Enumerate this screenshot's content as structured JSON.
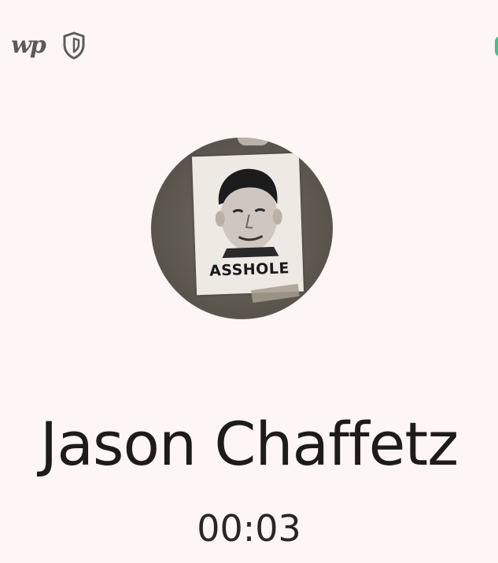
{
  "status_bar": {
    "left_icons": [
      "washington-post-icon",
      "shield-icon"
    ],
    "wp_logo_text": "wp"
  },
  "call": {
    "avatar_caption": "ASSHOLE",
    "contact_name": "Jason Chaffetz",
    "timer": "00:03"
  },
  "colors": {
    "background": "#fdf6f4",
    "text": "#1e1b1a",
    "accent_green": "#3ac38a"
  }
}
